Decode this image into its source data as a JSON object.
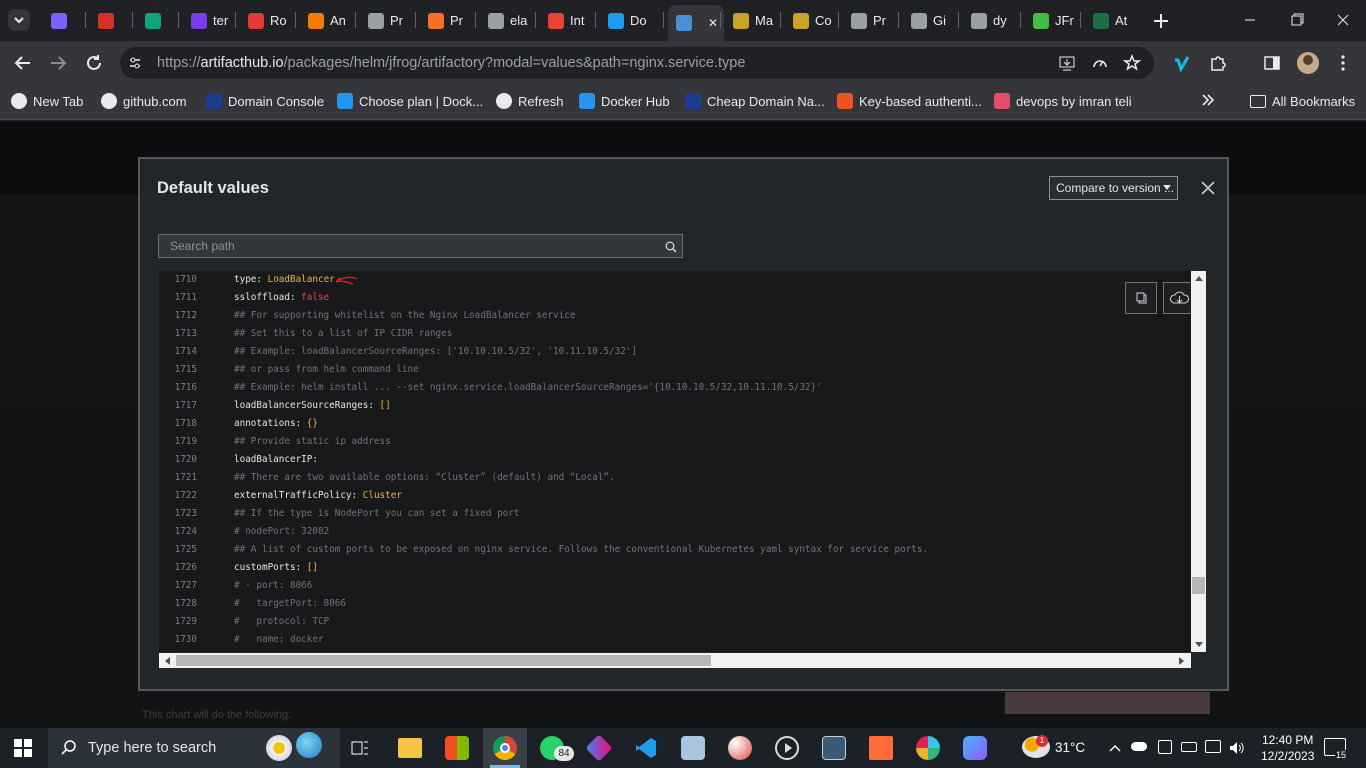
{
  "browser": {
    "tabs": [
      {
        "label": "",
        "color": "#7b61ff"
      },
      {
        "label": "",
        "color": "#d93025"
      },
      {
        "label": "",
        "color": "#10a37f"
      },
      {
        "label": "ter",
        "color": "#7c3aed"
      },
      {
        "label": "Ro",
        "color": "#e53935"
      },
      {
        "label": "An",
        "color": "#f57c00"
      },
      {
        "label": "Pr",
        "color": "#9aa0a6"
      },
      {
        "label": "Pr",
        "color": "#fc6d26"
      },
      {
        "label": "ela",
        "color": "#9aa0a6"
      },
      {
        "label": "Int",
        "color": "#ea4335"
      },
      {
        "label": "Do",
        "color": "#1d9bf0"
      },
      {
        "label": "",
        "color": "#4a90d9"
      },
      {
        "label": "Ma",
        "color": "#c9a227"
      },
      {
        "label": "Co",
        "color": "#c9a227"
      },
      {
        "label": "Pr",
        "color": "#9aa0a6"
      },
      {
        "label": "Gi",
        "color": "#9aa0a6"
      },
      {
        "label": "dy",
        "color": "#9aa0a6"
      },
      {
        "label": "JFr",
        "color": "#40be46"
      },
      {
        "label": "At",
        "color": "#1d6f42"
      }
    ],
    "url_prefix": "https://",
    "url_host": "artifacthub.io",
    "url_path": "/packages/helm/jfrog/artifactory?modal=values&path=nginx.service.type",
    "bookmarks": [
      {
        "label": "New Tab",
        "color": "#e8eaed"
      },
      {
        "label": "github.com",
        "color": "#e8eaed"
      },
      {
        "label": "Domain Console",
        "color": "#1a3d8f"
      },
      {
        "label": "Choose plan | Dock...",
        "color": "#2496ed"
      },
      {
        "label": "Refresh",
        "color": "#e8eaed"
      },
      {
        "label": "Docker Hub",
        "color": "#2496ed"
      },
      {
        "label": "Cheap Domain Na...",
        "color": "#1a3d8f"
      },
      {
        "label": "Key-based authenti...",
        "color": "#f25022"
      },
      {
        "label": "devops by imran teli",
        "color": "#e54b6b"
      }
    ],
    "all_bookmarks": "All Bookmarks"
  },
  "modal": {
    "title": "Default values",
    "compare_label": "Compare to version ...",
    "search_placeholder": "Search path"
  },
  "code_lines": [
    {
      "num": "1710",
      "parts": [
        [
          "k",
          "type: "
        ],
        [
          "v",
          "LoadBalancer"
        ]
      ]
    },
    {
      "num": "1711",
      "parts": [
        [
          "k",
          "ssloffload: "
        ],
        [
          "f",
          "false"
        ]
      ]
    },
    {
      "num": "1712",
      "parts": [
        [
          "c",
          "## For supporting whitelist on the Nginx LoadBalancer service"
        ]
      ]
    },
    {
      "num": "1713",
      "parts": [
        [
          "c",
          "## Set this to a list of IP CIDR ranges"
        ]
      ]
    },
    {
      "num": "1714",
      "parts": [
        [
          "c",
          "## Example: loadBalancerSourceRanges: ['10.10.10.5/32', '10.11.10.5/32']"
        ]
      ]
    },
    {
      "num": "1715",
      "parts": [
        [
          "c",
          "## or pass from helm command line"
        ]
      ]
    },
    {
      "num": "1716",
      "parts": [
        [
          "c",
          "## Example: helm install ... --set nginx.service.loadBalancerSourceRanges='{10.10.10.5/32,10.11.10.5/32}'"
        ]
      ]
    },
    {
      "num": "1717",
      "parts": [
        [
          "k",
          "loadBalancerSourceRanges: "
        ],
        [
          "v",
          "[]"
        ]
      ]
    },
    {
      "num": "1718",
      "parts": [
        [
          "k",
          "annotations: "
        ],
        [
          "v",
          "{}"
        ]
      ]
    },
    {
      "num": "1719",
      "parts": [
        [
          "c",
          "## Provide static ip address"
        ]
      ]
    },
    {
      "num": "1720",
      "parts": [
        [
          "k",
          "loadBalancerIP:"
        ]
      ]
    },
    {
      "num": "1721",
      "parts": [
        [
          "c",
          "## There are two available options: “Cluster” (default) and “Local”."
        ]
      ]
    },
    {
      "num": "1722",
      "parts": [
        [
          "k",
          "externalTrafficPolicy: "
        ],
        [
          "v",
          "Cluster"
        ]
      ]
    },
    {
      "num": "1723",
      "parts": [
        [
          "c",
          "## If the type is NodePort you can set a fixed port"
        ]
      ]
    },
    {
      "num": "1724",
      "parts": [
        [
          "c",
          "# nodePort: 32082"
        ]
      ]
    },
    {
      "num": "1725",
      "parts": [
        [
          "c",
          "## A list of custom ports to be exposed on nginx service. Follows the conventional Kubernetes yaml syntax for service ports."
        ]
      ]
    },
    {
      "num": "1726",
      "parts": [
        [
          "k",
          "customPorts: "
        ],
        [
          "v",
          "[]"
        ]
      ]
    },
    {
      "num": "1727",
      "parts": [
        [
          "c",
          "# - port: 8066"
        ]
      ]
    },
    {
      "num": "1728",
      "parts": [
        [
          "c",
          "#   targetPort: 8066"
        ]
      ]
    },
    {
      "num": "1729",
      "parts": [
        [
          "c",
          "#   protocol: TCP"
        ]
      ]
    },
    {
      "num": "1730",
      "parts": [
        [
          "c",
          "#   name: docker"
        ]
      ]
    }
  ],
  "page_bg_text": "This chart will do the following:",
  "taskbar": {
    "search_placeholder": "Type here to search",
    "whatsapp_badge": "84",
    "weather_badge": "1",
    "temperature": "31°C",
    "time": "12:40 PM",
    "date": "12/2/2023",
    "notification_count": "15"
  }
}
